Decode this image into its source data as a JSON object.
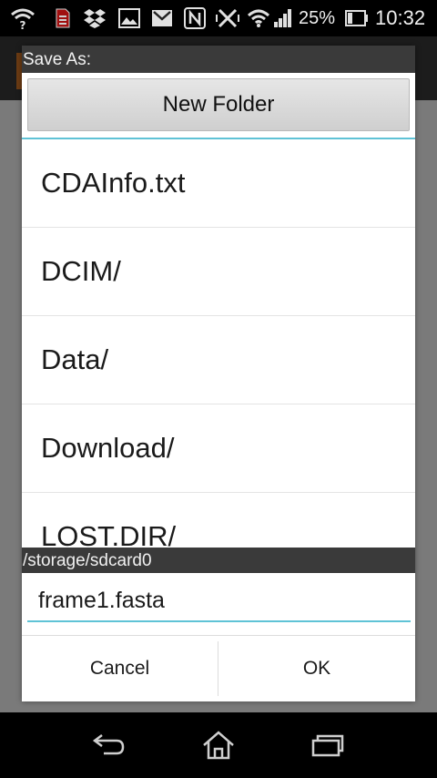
{
  "status_bar": {
    "battery_percent": "25%",
    "time": "10:32",
    "icons": [
      "wifi-question-icon",
      "sim-icon",
      "dropbox-icon",
      "gallery-icon",
      "gmail-icon",
      "nfc-icon",
      "vibrate-off-icon",
      "wifi-icon",
      "signal-icon",
      "battery-icon"
    ]
  },
  "dialog": {
    "title": "Save As:",
    "new_folder_label": "New Folder",
    "files": [
      {
        "name": "CDAInfo.txt"
      },
      {
        "name": "DCIM/"
      },
      {
        "name": "Data/"
      },
      {
        "name": "Download/"
      },
      {
        "name": "LOST.DIR/"
      }
    ],
    "current_path": "/storage/sdcard0",
    "filename_value": "frame1.fasta",
    "cancel_label": "Cancel",
    "ok_label": "OK",
    "accent_color": "#5fc3d6"
  },
  "nav_bar": {
    "icons": [
      "back-icon",
      "home-icon",
      "recent-apps-icon"
    ]
  }
}
